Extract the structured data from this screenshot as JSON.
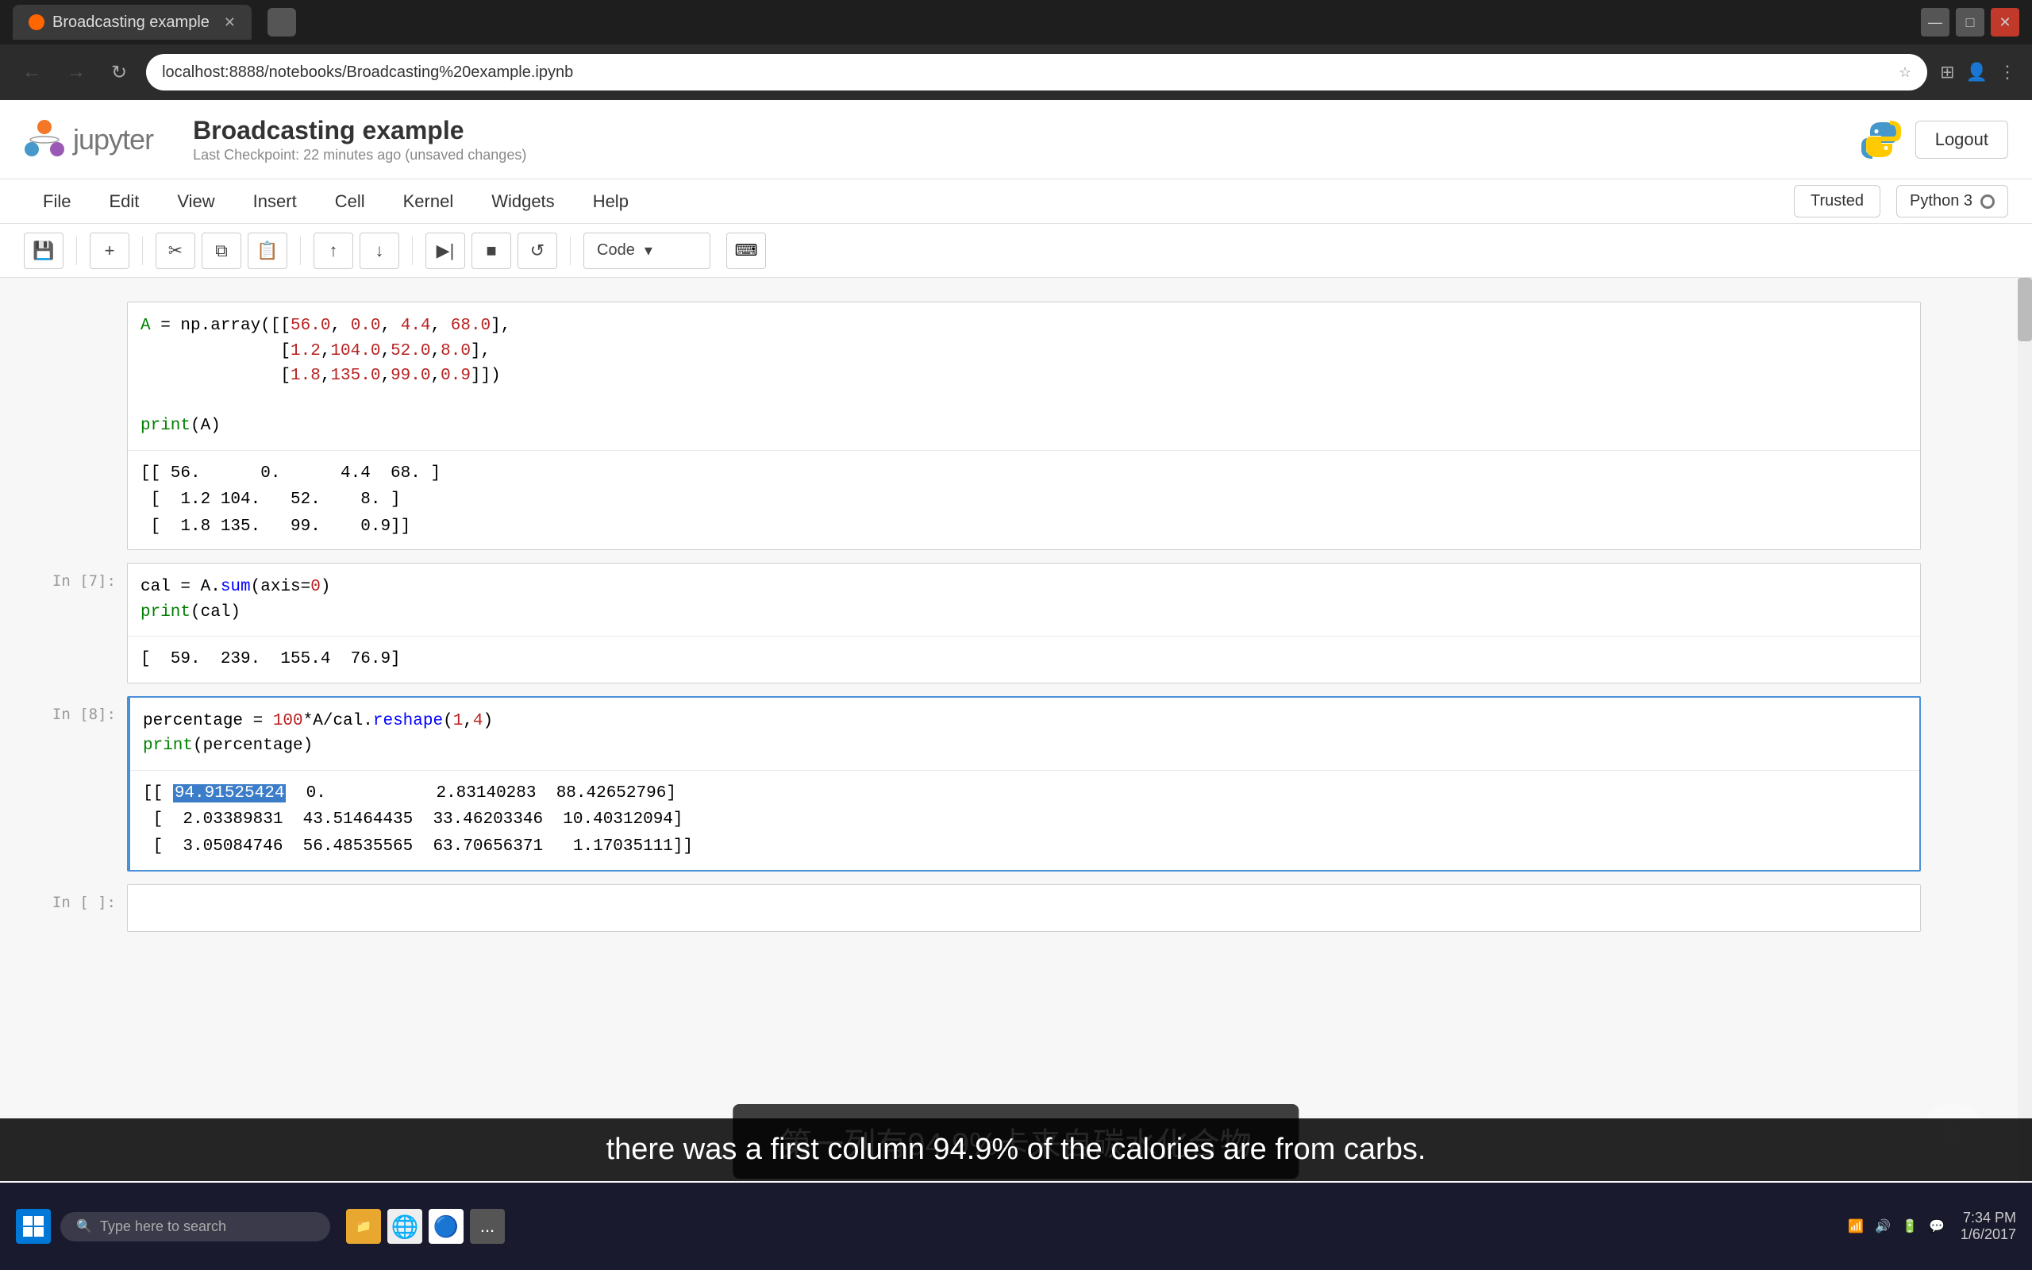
{
  "browser": {
    "tab_title": "Broadcasting example",
    "tab2_empty": true,
    "url": "localhost:8888/notebooks/Broadcasting%20example.ipynb",
    "window_controls": [
      "minimize",
      "maximize",
      "close"
    ]
  },
  "jupyter": {
    "logo_text": "jupyter",
    "notebook_title": "Broadcasting example",
    "checkpoint_text": "Last Checkpoint: 22 minutes ago (unsaved changes)",
    "logout_label": "Logout",
    "menu": [
      "File",
      "Edit",
      "View",
      "Insert",
      "Cell",
      "Kernel",
      "Widgets",
      "Help"
    ],
    "trusted_label": "Trusted",
    "kernel_label": "Python 3",
    "cell_type": "Code",
    "toolbar_buttons": [
      "save",
      "add",
      "cut",
      "copy",
      "paste",
      "move_up",
      "move_down",
      "to_top",
      "stop",
      "restart"
    ],
    "cells": [
      {
        "id": "cell_np_array",
        "input_lines": [
          "A = np.array([[56.0, 0.0, 4.4, 68.0],",
          "              [1.2,104.0,52.0,8.0],",
          "              [1.8,135.0,99.0,0.9]])"
        ],
        "output_lines": [
          "print(A)"
        ],
        "output_result": "[[ 56.    0.    4.4  68. ]\n [  1.2 104.   52.    8. ]\n [  1.8 135.   99.    0.9]]"
      },
      {
        "id": "cell_7",
        "prompt": "In [7]:",
        "input_line1": "cal = A.sum(axis=0)",
        "input_line2": "print(cal)",
        "output": "[  59.  239.  155.4  76.9]"
      },
      {
        "id": "cell_8",
        "prompt": "In [8]:",
        "active": true,
        "input_line1": "percentage = 100*A/cal.reshape(1,4)",
        "input_line2": "print(percentage)",
        "output_line1": "[[ 94.91525424   0.           2.83140283  88.42652796]",
        "output_line2": "[  2.03389831  43.51464435  33.46203346  10.40312094]",
        "output_line3": "[  3.05084746  56.48535565  63.70656371   1.17035111]]",
        "highlight_value": "94.91525424"
      },
      {
        "id": "cell_empty",
        "prompt": "In [ ]:"
      }
    ]
  },
  "subtitles": {
    "chinese": "第一列有94.9%卡来自碳水化合物",
    "english": "there was a first column 94.9% of the calories are from carbs."
  },
  "taskbar": {
    "search_placeholder": "Type here to search",
    "time": "7:34 PM",
    "date": "1/6/2017"
  }
}
